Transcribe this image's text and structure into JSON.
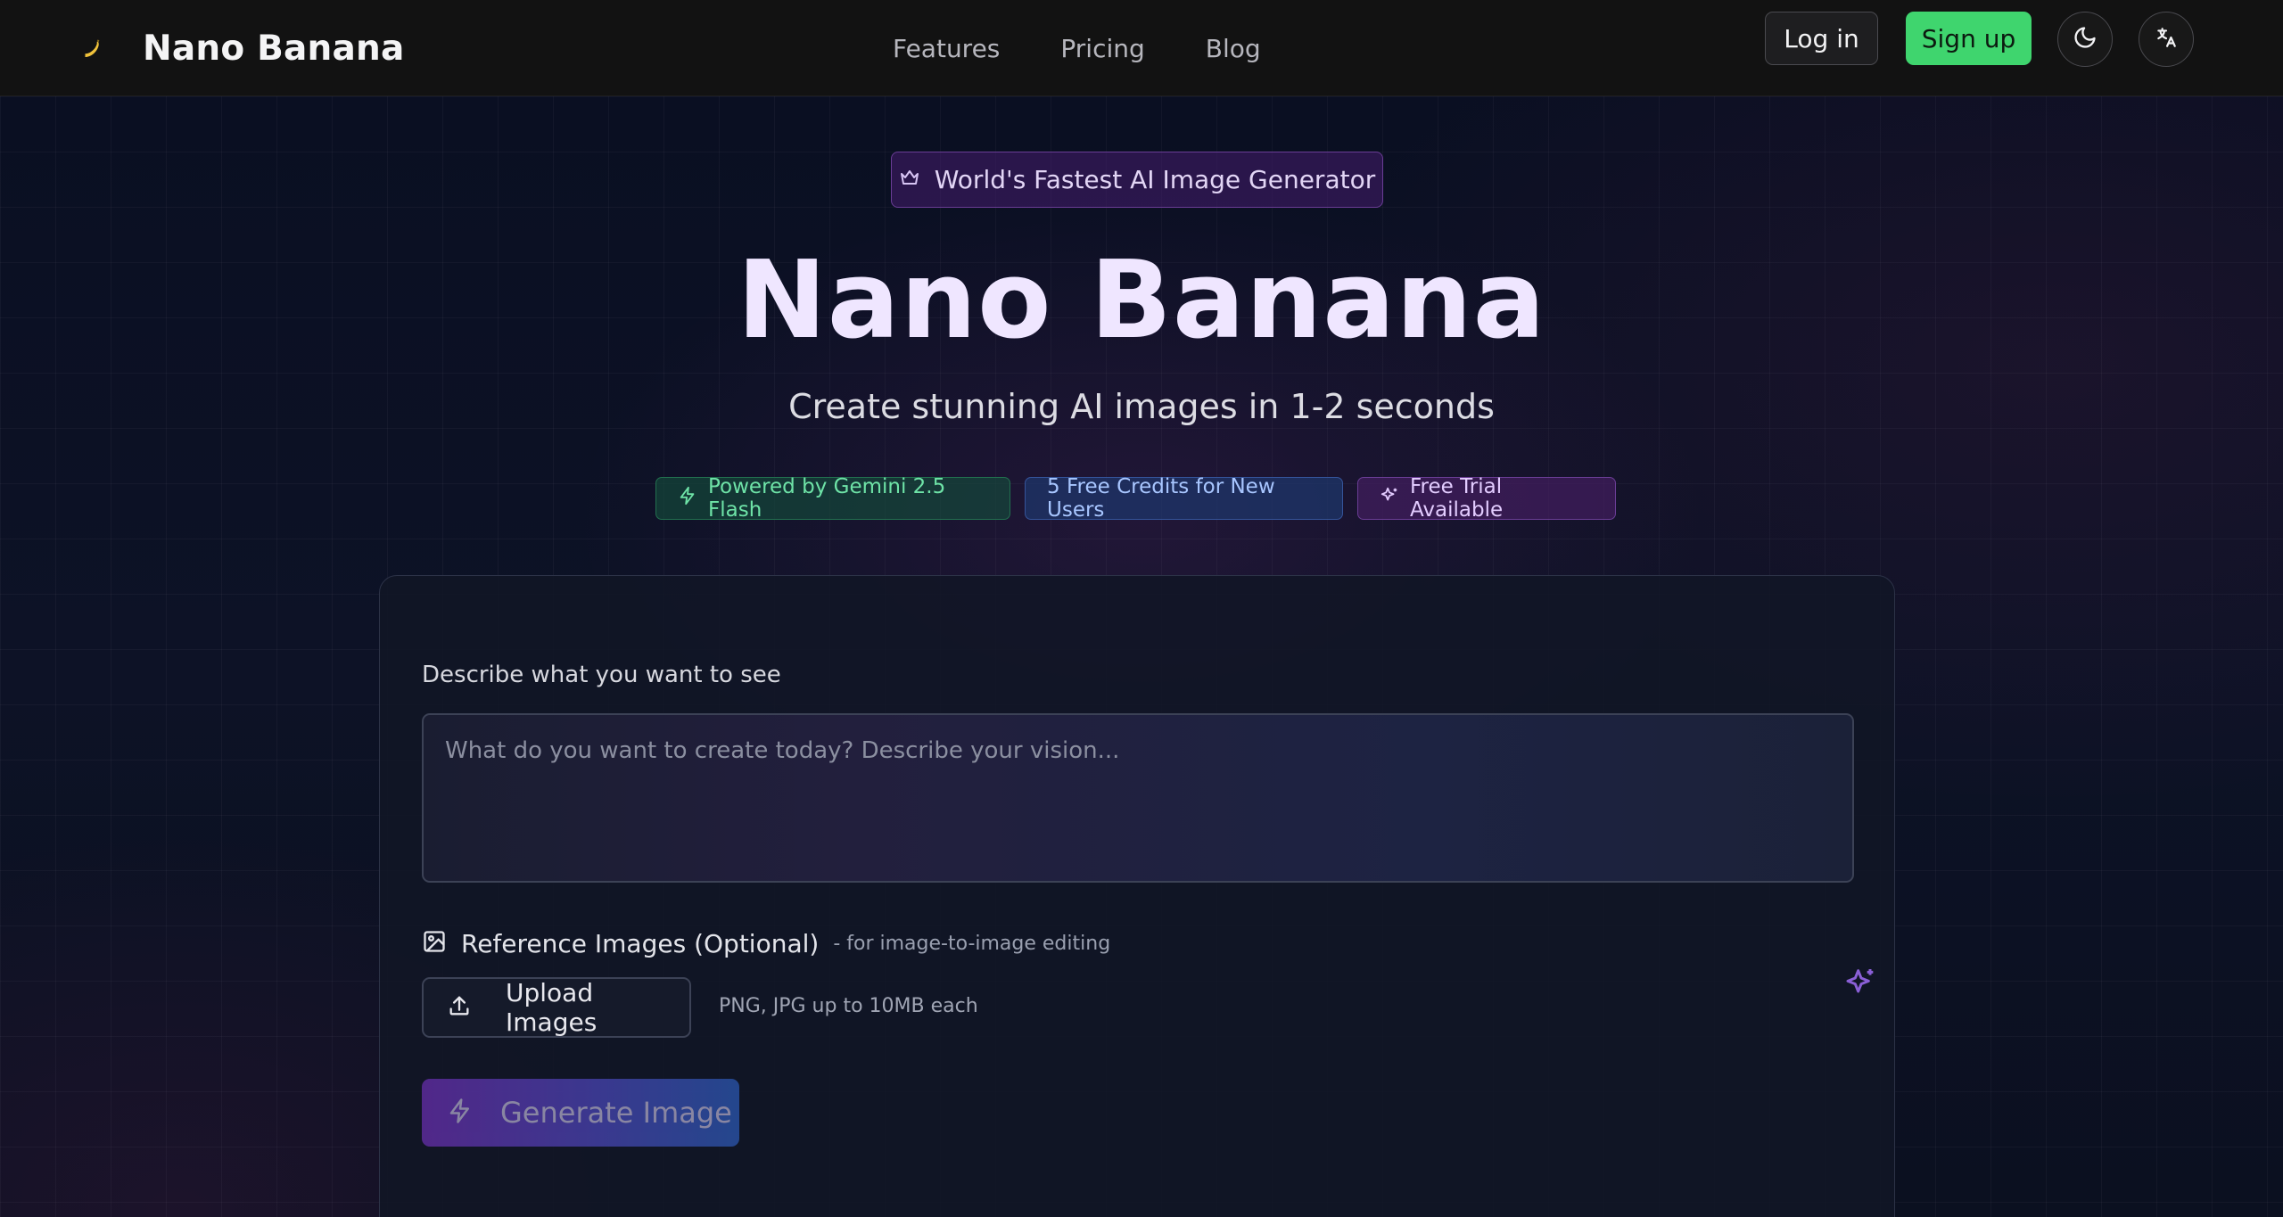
{
  "header": {
    "logo_icon": "banana-icon",
    "brand": "Nano Banana",
    "nav": [
      "Features",
      "Pricing",
      "Blog"
    ],
    "login_label": "Log in",
    "signup_label": "Sign up",
    "theme_icon": "moon-icon",
    "language_icon": "translate-icon"
  },
  "hero": {
    "badge": "World's Fastest AI Image Generator",
    "badge_icon": "crown-icon",
    "title": "Nano Banana",
    "subtitle": "Create stunning AI images in 1-2 seconds",
    "pills": [
      {
        "label": "Powered by Gemini 2.5 Flash",
        "icon": "lightning-icon",
        "color": "#6ee3a7"
      },
      {
        "label": "5 Free Credits for New Users",
        "color": "#a8c6ff"
      },
      {
        "label": "Free Trial Available",
        "icon": "sparkles-icon",
        "color": "#e3ccff"
      }
    ]
  },
  "generator": {
    "prompt_label": "Describe what you want to see",
    "prompt_placeholder": "What do you want to create today? Describe your vision...",
    "prompt_value": "",
    "reference_title": "Reference Images (Optional)",
    "reference_note": "- for image-to-image editing",
    "upload_label": "Upload Images",
    "upload_hint": "PNG, JPG up to 10MB each",
    "generate_label": "Generate Image"
  },
  "colors": {
    "accent_green": "#3fd56e",
    "accent_purple": "#6a2fb0",
    "accent_blue": "#2c5ab5"
  }
}
